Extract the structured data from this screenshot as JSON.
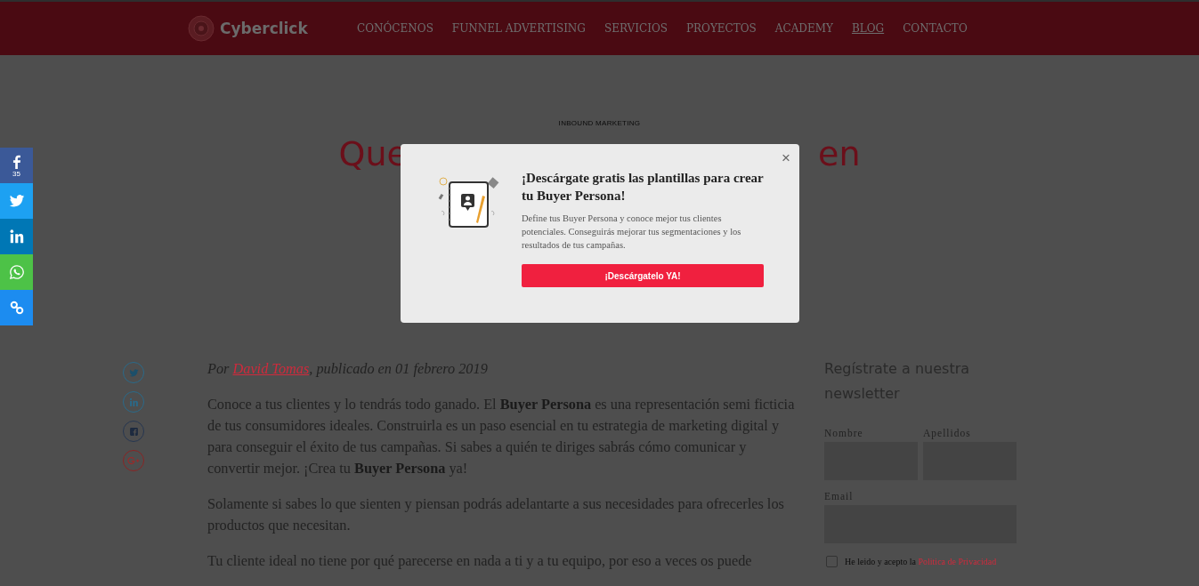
{
  "header": {
    "logo": "Cyberclick",
    "nav": [
      {
        "label": "CONÓCENOS",
        "selected": false
      },
      {
        "label": "FUNNEL ADVERTISING",
        "selected": false
      },
      {
        "label": "SERVICIOS",
        "selected": false
      },
      {
        "label": "PROYECTOS",
        "selected": false
      },
      {
        "label": "ACADEMY",
        "selected": false
      },
      {
        "label": "BLOG",
        "selected": true
      },
      {
        "label": "CONTACTO",
        "selected": false
      }
    ]
  },
  "share_bar": [
    {
      "kind": "facebook",
      "color": "#3b5998",
      "count": "35"
    },
    {
      "kind": "twitter",
      "color": "#1da1f2"
    },
    {
      "kind": "linkedin",
      "color": "#0077b5"
    },
    {
      "kind": "whatsapp",
      "color": "#4dc247"
    },
    {
      "kind": "link",
      "color": "#1c8cf0"
    }
  ],
  "article": {
    "category": "INBOUND MARKETING",
    "title_visible_parts": [
      "Que",
      "en"
    ],
    "share_icons": [
      {
        "kind": "twitter"
      },
      {
        "kind": "linkedin"
      },
      {
        "kind": "facebook"
      },
      {
        "kind": "googleplus"
      }
    ],
    "byline": {
      "prefix": "Por",
      "author": "David Tomas",
      "suffix": ", publicado en 01 febrero 2019"
    },
    "paragraphs": [
      "Conoce a tus clientes y lo tendrás todo ganado. El **Buyer Persona** es una representación semi ficticia de tus consumidores ideales. Construirla es un paso esencial en tu estrategia de marketing digital y para conseguir el éxito de tus campañas. Si sabes a quién te diriges sabrás cómo comunicar y convertir mejor. ¡Crea tu **Buyer Persona** ya!",
      "Solamente si sabes lo que sienten y piensan podrás adelantarte a sus necesidades para ofrecerles los productos que necesitan.",
      "Tu cliente ideal no tiene por qué parecerse en nada a ti y a tu equipo, por eso a veces os puede"
    ]
  },
  "newsletter": {
    "title": "Regístrate a nuestra newsletter",
    "fields": [
      {
        "label": "Nombre"
      },
      {
        "label": "Apellidos"
      },
      {
        "label": "Email"
      }
    ],
    "consent": {
      "checked": false,
      "text": "He leido y acepto la",
      "link": "Politica de Privacidad"
    }
  },
  "modal": {
    "title": "¡Descárgate gratis las plantillas para crear tu Buyer Persona!",
    "text": "Define tus Buyer Persona y conoce mejor tus clientes potenciales. Conseguirás mejorar tus segmentaciones y los resultados de tus campañas.",
    "button": "¡Descárgatelo YA!",
    "close": "×"
  }
}
